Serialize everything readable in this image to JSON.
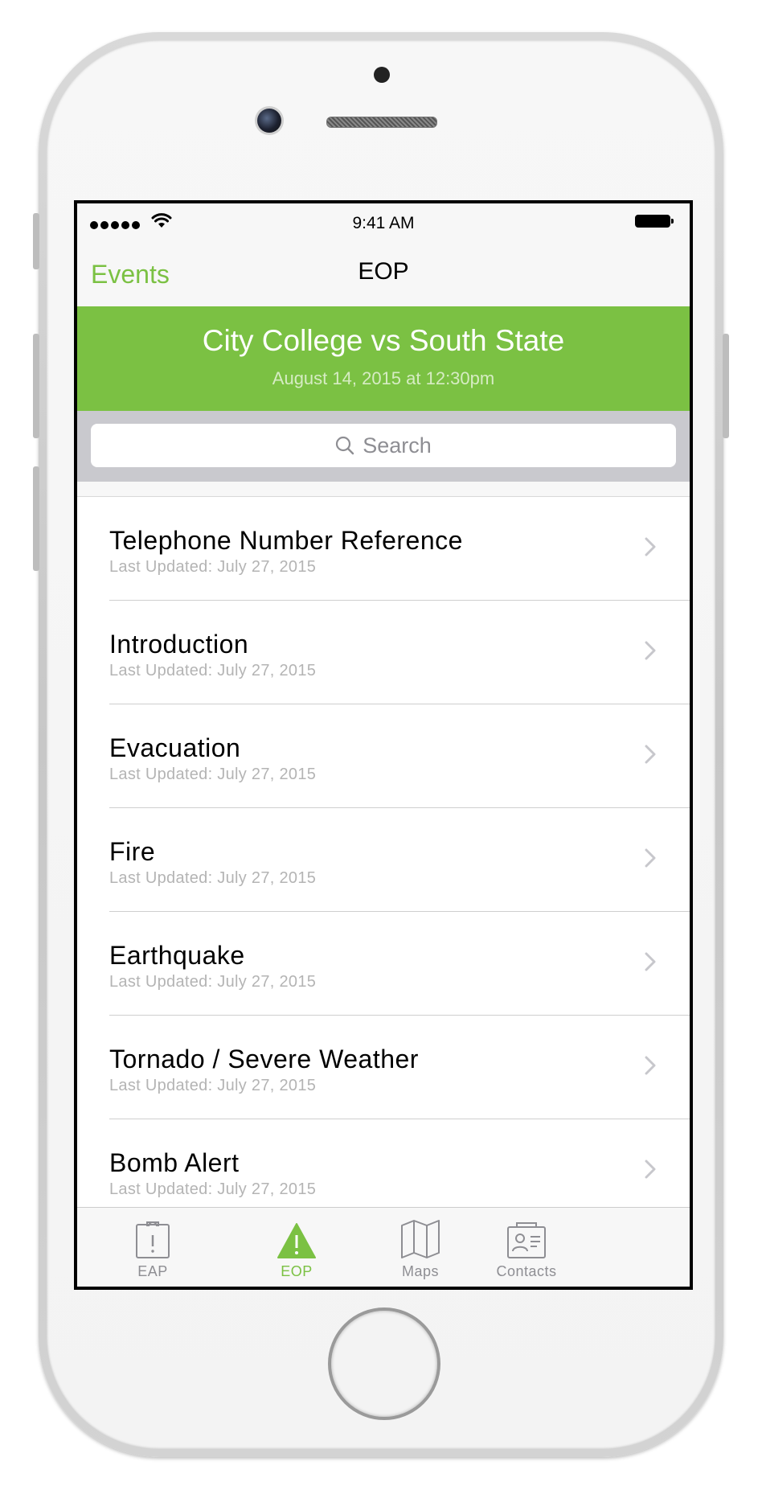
{
  "status_bar": {
    "time": "9:41 AM"
  },
  "nav": {
    "back_label": "Events",
    "title": "EOP"
  },
  "event": {
    "title": "City College vs South State",
    "date": "August 14, 2015 at 12:30pm"
  },
  "search": {
    "placeholder": "Search"
  },
  "items": [
    {
      "title": "Telephone Number Reference",
      "subtitle": "Last Updated: July 27, 2015"
    },
    {
      "title": "Introduction",
      "subtitle": "Last Updated: July 27, 2015"
    },
    {
      "title": "Evacuation",
      "subtitle": "Last Updated: July 27, 2015"
    },
    {
      "title": "Fire",
      "subtitle": "Last Updated: July 27, 2015"
    },
    {
      "title": "Earthquake",
      "subtitle": "Last Updated: July 27, 2015"
    },
    {
      "title": "Tornado / Severe Weather",
      "subtitle": "Last Updated: July 27, 2015"
    },
    {
      "title": "Bomb Alert",
      "subtitle": "Last Updated: July 27, 2015"
    }
  ],
  "tabs": [
    {
      "label": "EAP",
      "icon": "clipboard-alert-icon",
      "active": false
    },
    {
      "label": "EOP",
      "icon": "warning-triangle-icon",
      "active": true
    },
    {
      "label": "Maps",
      "icon": "map-icon",
      "active": false
    },
    {
      "label": "Contacts",
      "icon": "contact-card-icon",
      "active": false
    }
  ],
  "colors": {
    "accent": "#7bc143",
    "inactive": "#8e8e93"
  }
}
